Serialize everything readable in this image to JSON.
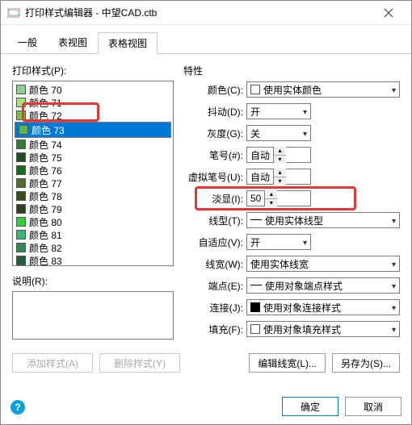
{
  "title": "打印样式编辑器 - 中望CAD.ctb",
  "tabs": [
    "一般",
    "表视图",
    "表格视图"
  ],
  "activeTab": 2,
  "leftGroupLabel": "打印样式(P):",
  "colors": [
    {
      "label": "颜色 70",
      "hex": "#8fce8f"
    },
    {
      "label": "颜色 71",
      "hex": "#a4e27d"
    },
    {
      "label": "颜色 72",
      "hex": "#7bc043"
    },
    {
      "label": "颜色 73",
      "hex": "#5fb54a",
      "selected": true
    },
    {
      "label": "颜色 74",
      "hex": "#2e7d32"
    },
    {
      "label": "颜色 75",
      "hex": "#224d22"
    },
    {
      "label": "颜色 76",
      "hex": "#166b16"
    },
    {
      "label": "颜色 77",
      "hex": "#556b2f"
    },
    {
      "label": "颜色 78",
      "hex": "#344d1a"
    },
    {
      "label": "颜色 79",
      "hex": "#2e4420"
    },
    {
      "label": "颜色 80",
      "hex": "#33cc33"
    },
    {
      "label": "颜色 81",
      "hex": "#3cb371"
    },
    {
      "label": "颜色 82",
      "hex": "#2e8b57"
    },
    {
      "label": "颜色 83",
      "hex": "#206040"
    }
  ],
  "descLabel": "说明(R):",
  "propsTitle": "特性",
  "props": {
    "color": {
      "label": "颜色(C):",
      "value": "使用实体颜色",
      "checkbox": true
    },
    "dither": {
      "label": "抖动(D):",
      "value": "开"
    },
    "gray": {
      "label": "灰度(G):",
      "value": "关"
    },
    "pen": {
      "label": "笔号(#):",
      "value": "自动",
      "spin": true
    },
    "vpen": {
      "label": "虚拟笔号(U):",
      "value": "自动",
      "spin": true
    },
    "screen": {
      "label": "淡显(I):",
      "value": "50",
      "spin": true,
      "hl": true,
      "input": true
    },
    "ltype": {
      "label": "线型(T):",
      "value": "使用实体线型",
      "line": true
    },
    "adapt": {
      "label": "自适应(V):",
      "value": "开"
    },
    "lweight": {
      "label": "线宽(W):",
      "value": "使用实体线宽"
    },
    "endcap": {
      "label": "端点(E):",
      "value": "使用对象端点样式",
      "dash": true
    },
    "join": {
      "label": "连接(J):",
      "value": "使用对象连接样式",
      "dash": true,
      "joinicon": true
    },
    "fill": {
      "label": "填充(F):",
      "value": "使用对象填充样式",
      "checkbox": true
    }
  },
  "buttons": {
    "add": "添加样式(A)",
    "del": "删除样式(Y)",
    "editlw": "编辑线宽(L)...",
    "saveas": "另存为(S)..."
  },
  "footer": {
    "ok": "确定",
    "cancel": "取消"
  }
}
